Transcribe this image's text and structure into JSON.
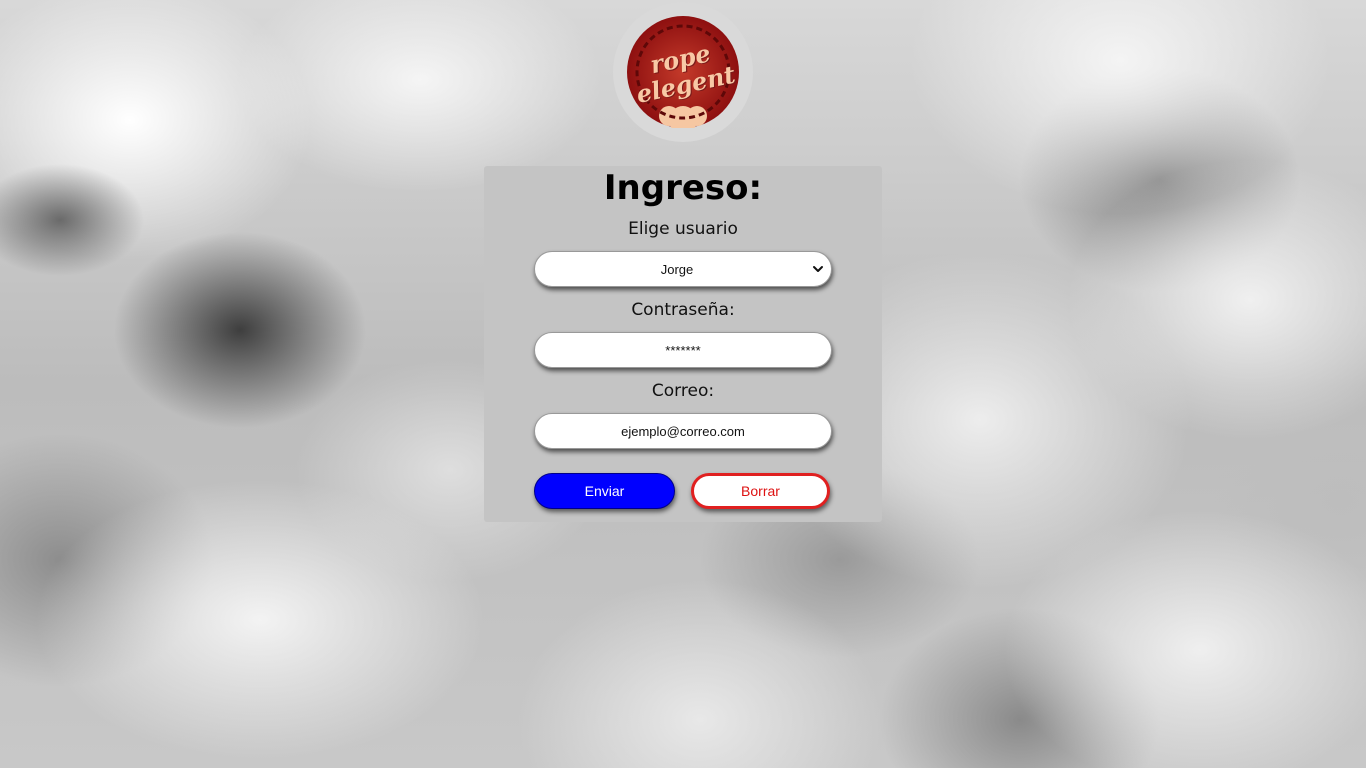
{
  "logo": {
    "line1": "rope",
    "line2": "elegent"
  },
  "form": {
    "title": "Ingreso:",
    "user_label": "Elige usuario",
    "user_selected": "Jorge",
    "password_label": "Contraseña:",
    "password_value": "*******",
    "email_label": "Correo:",
    "email_value": "ejemplo@correo.com",
    "submit_label": "Enviar",
    "reset_label": "Borrar"
  },
  "colors": {
    "panel": "#c4c4c4",
    "submit": "#0000ff",
    "reset_border": "#e02020",
    "logo_badge": "#8e1010",
    "logo_text": "#f8c9a6"
  },
  "icons": {
    "select_arrow": "chevron-down-icon"
  }
}
